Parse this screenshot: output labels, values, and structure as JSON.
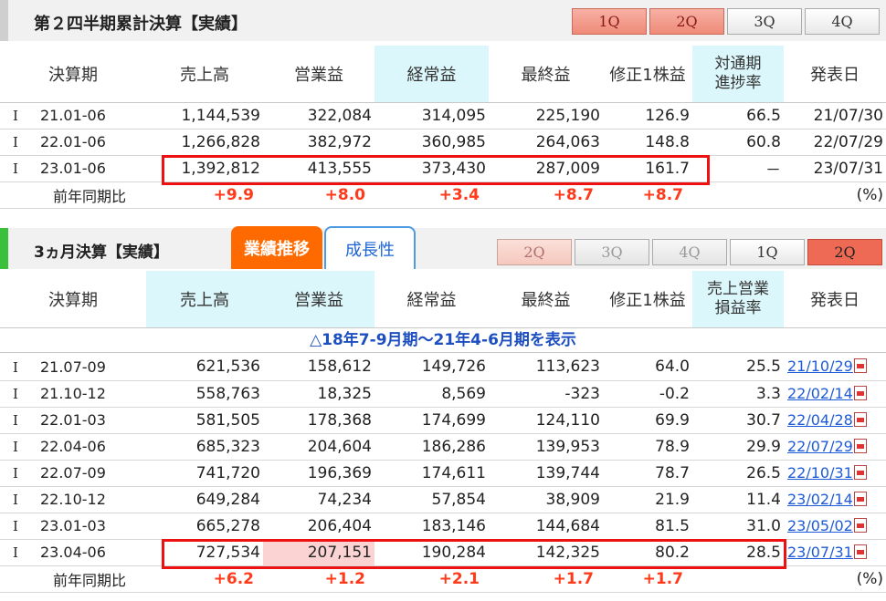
{
  "section1": {
    "title": "第２四半期累計決算【実績】",
    "tabs": [
      "1Q",
      "2Q",
      "3Q",
      "4Q"
    ],
    "headers": [
      "決算期",
      "売上高",
      "営業益",
      "経常益",
      "最終益",
      "修正1株益",
      "対通期\n進捗率",
      "発表日"
    ],
    "rows": [
      {
        "mark": "I",
        "period": "21.01-06",
        "sales": "1,144,539",
        "op": "322,084",
        "ord": "314,095",
        "net": "225,190",
        "eps": "126.9",
        "progress": "66.5",
        "date": "21/07/30"
      },
      {
        "mark": "I",
        "period": "22.01-06",
        "sales": "1,266,828",
        "op": "382,972",
        "ord": "360,985",
        "net": "264,063",
        "eps": "148.8",
        "progress": "60.8",
        "date": "22/07/29"
      },
      {
        "mark": "I",
        "period": "23.01-06",
        "sales": "1,392,812",
        "op": "413,555",
        "ord": "373,430",
        "net": "287,009",
        "eps": "161.7",
        "progress": "－",
        "date": "23/07/31"
      }
    ],
    "yoy": {
      "label": "前年同期比",
      "sales": "+9.9",
      "op": "+8.0",
      "ord": "+3.4",
      "net": "+8.7",
      "eps": "+8.7",
      "unit": "(%)"
    }
  },
  "section2": {
    "title": "3ヵ月決算【実績】",
    "subtabs": [
      "業績推移",
      "成長性"
    ],
    "tabs": [
      "2Q",
      "3Q",
      "4Q",
      "1Q",
      "2Q"
    ],
    "headers": [
      "決算期",
      "売上高",
      "営業益",
      "経常益",
      "最終益",
      "修正1株益",
      "売上営業\n損益率",
      "発表日"
    ],
    "note": "△18年7-9月期～21年4-6月期を表示",
    "rows": [
      {
        "mark": "I",
        "period": "21.07-09",
        "sales": "621,536",
        "op": "158,612",
        "ord": "149,726",
        "net": "113,623",
        "eps": "64.0",
        "margin": "25.5",
        "date": "21/10/29"
      },
      {
        "mark": "I",
        "period": "21.10-12",
        "sales": "558,763",
        "op": "18,325",
        "ord": "8,569",
        "net": "-323",
        "eps": "-0.2",
        "margin": "3.3",
        "date": "22/02/14"
      },
      {
        "mark": "I",
        "period": "22.01-03",
        "sales": "581,505",
        "op": "178,368",
        "ord": "174,699",
        "net": "124,110",
        "eps": "69.9",
        "margin": "30.7",
        "date": "22/04/28"
      },
      {
        "mark": "I",
        "period": "22.04-06",
        "sales": "685,323",
        "op": "204,604",
        "ord": "186,286",
        "net": "139,953",
        "eps": "78.9",
        "margin": "29.9",
        "date": "22/07/29"
      },
      {
        "mark": "I",
        "period": "22.07-09",
        "sales": "741,720",
        "op": "196,369",
        "ord": "174,611",
        "net": "139,744",
        "eps": "78.7",
        "margin": "26.5",
        "date": "22/10/31"
      },
      {
        "mark": "I",
        "period": "22.10-12",
        "sales": "649,284",
        "op": "74,234",
        "ord": "57,854",
        "net": "38,909",
        "eps": "21.9",
        "margin": "11.4",
        "date": "23/02/14"
      },
      {
        "mark": "I",
        "period": "23.01-03",
        "sales": "665,278",
        "op": "206,404",
        "ord": "183,146",
        "net": "144,684",
        "eps": "81.5",
        "margin": "31.0",
        "date": "23/05/02"
      },
      {
        "mark": "I",
        "period": "23.04-06",
        "sales": "727,534",
        "op": "207,151",
        "ord": "190,284",
        "net": "142,325",
        "eps": "80.2",
        "margin": "28.5",
        "date": "23/07/31"
      }
    ],
    "yoy": {
      "label": "前年同期比",
      "sales": "+6.2",
      "op": "+1.2",
      "ord": "+2.1",
      "net": "+1.7",
      "eps": "+1.7",
      "unit": "(%)"
    }
  },
  "colors": {
    "accent_orange": "#ff6a00",
    "up_red": "#ff3a1a",
    "link_blue": "#1d5bd8",
    "highlight_box": "#e11111"
  }
}
